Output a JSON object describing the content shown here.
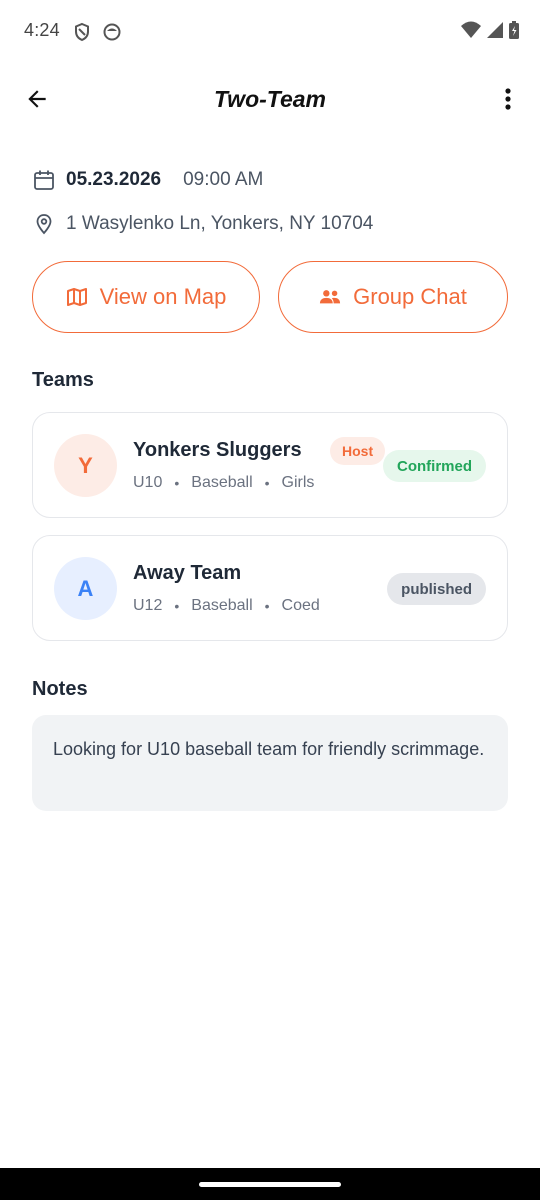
{
  "status_bar": {
    "time": "4:24",
    "icons": [
      "shield-icon",
      "face-icon",
      "wifi-icon",
      "signal-icon",
      "battery-icon"
    ]
  },
  "app_bar": {
    "title": "Two-Team",
    "back_icon": "arrow-back-icon",
    "more_icon": "more-vert-icon"
  },
  "event": {
    "date": "05.23.2026",
    "time": "09:00 AM",
    "location": "1 Wasylenko Ln, Yonkers, NY 10704"
  },
  "actions": {
    "view_map_label": "View on Map",
    "group_chat_label": "Group Chat"
  },
  "teams_section": {
    "title": "Teams",
    "teams": [
      {
        "initial": "Y",
        "name": "Yonkers Sluggers",
        "age": "U10",
        "sport": "Baseball",
        "gender": "Girls",
        "role_badge": "Host",
        "status": "Confirmed"
      },
      {
        "initial": "A",
        "name": "Away Team",
        "age": "U12",
        "sport": "Baseball",
        "gender": "Coed",
        "status": "published"
      }
    ]
  },
  "notes_section": {
    "title": "Notes",
    "text": "Looking for U10 baseball team for friendly scrimmage."
  },
  "colors": {
    "accent": "#f26b3a",
    "confirmed": "#22a55a",
    "avatar_blue": "#3b82f6"
  }
}
